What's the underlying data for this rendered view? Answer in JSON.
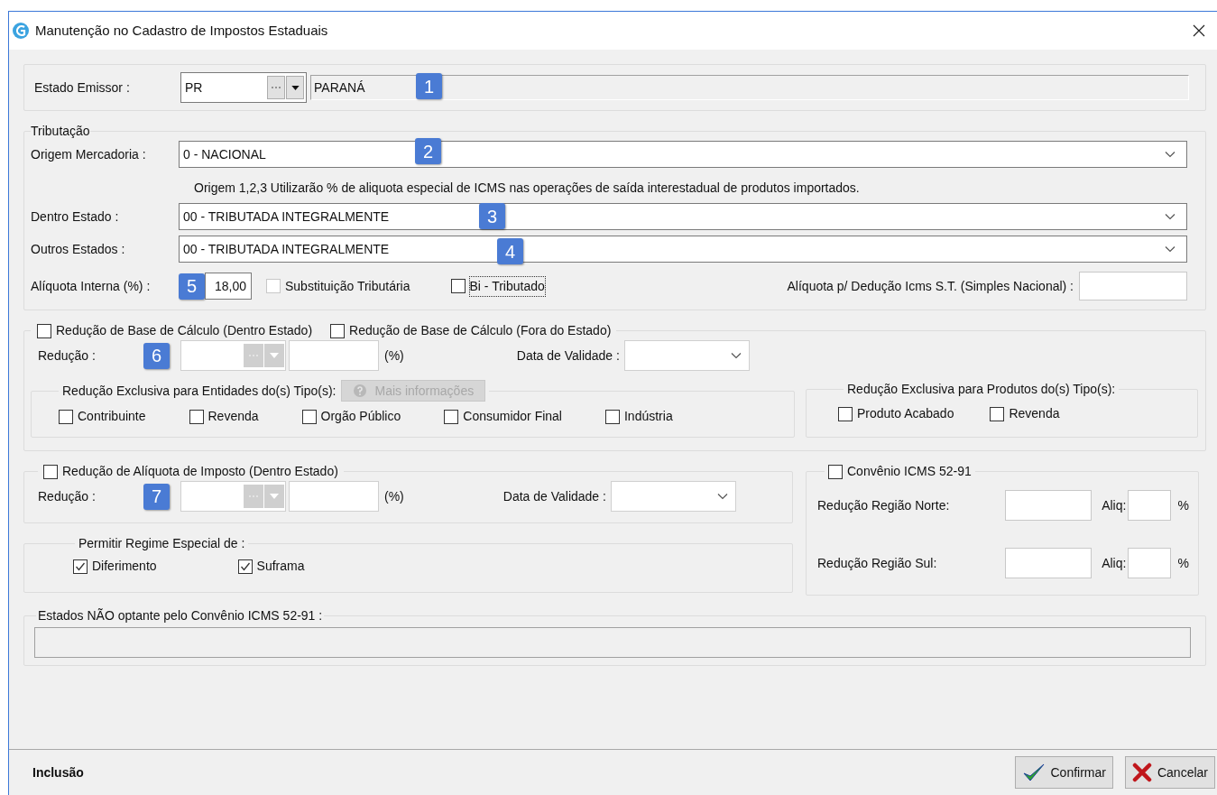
{
  "window": {
    "title": "Manutenção no Cadastro de Impostos Estaduais"
  },
  "estado_emissor": {
    "label": "Estado Emissor :",
    "code": "PR",
    "name": "PARANÁ",
    "badge": "1"
  },
  "tributacao": {
    "legend": "Tributação",
    "origem": {
      "label": "Origem Mercadoria :",
      "value": "0 - NACIONAL",
      "badge": "2"
    },
    "note": "Origem 1,2,3 Utilizarão % de aliquota especial de ICMS nas operações de saída interestadual de produtos importados.",
    "dentro": {
      "label": "Dentro Estado :",
      "value": "00 - TRIBUTADA INTEGRALMENTE",
      "badge": "3"
    },
    "outros": {
      "label": "Outros Estados :",
      "value": "00 - TRIBUTADA INTEGRALMENTE",
      "badge": "4"
    },
    "aliquota": {
      "label": "Alíquota Interna (%) :",
      "value": "18,00",
      "badge": "5"
    },
    "checks": [
      {
        "label": "Substituição Tributária",
        "checked": false,
        "disabled": true,
        "focused": false
      },
      {
        "label": "Bi - Tributado",
        "checked": false,
        "disabled": false,
        "focused": true
      }
    ],
    "deducao": {
      "label": "Alíquota p/ Dedução Icms S.T. (Simples Nacional) :"
    }
  },
  "reducao_base": {
    "legend_checks": [
      {
        "label": "Redução de Base de Cálculo (Dentro Estado)",
        "checked": false
      },
      {
        "label": "Redução de Base de Cálculo (Fora do Estado)",
        "checked": false
      }
    ],
    "reducao_label": "Redução :",
    "badge": "6",
    "percent_label": "(%)",
    "validade_label": "Data de Validade :",
    "entidades": {
      "legend": "Redução Exclusiva para Entidades do(s) Tipo(s):",
      "info_button": {
        "label": "Mais informações",
        "disabled": true
      },
      "options": [
        {
          "label": "Contribuinte",
          "checked": false
        },
        {
          "label": "Revenda",
          "checked": false
        },
        {
          "label": "Orgão Público",
          "checked": false
        },
        {
          "label": "Consumidor Final",
          "checked": false
        },
        {
          "label": "Indústria",
          "checked": false
        }
      ]
    },
    "produtos": {
      "legend": "Redução Exclusiva para Produtos do(s) Tipo(s):",
      "options": [
        {
          "label": "Produto Acabado",
          "checked": false
        },
        {
          "label": "Revenda",
          "checked": false
        }
      ]
    }
  },
  "reducao_aliquota": {
    "legend_check": {
      "label": "Redução de Alíquota de Imposto (Dentro Estado)",
      "checked": false
    },
    "reducao_label": "Redução :",
    "badge": "7",
    "percent_label": "(%)",
    "validade_label": "Data de Validade :"
  },
  "regime": {
    "legend": "Permitir Regime Especial de :",
    "options": [
      {
        "label": "Diferimento",
        "checked": true
      },
      {
        "label": "Suframa",
        "checked": true
      }
    ]
  },
  "convenio": {
    "legend_check": {
      "label": "Convênio ICMS 52-91",
      "checked": false
    },
    "rows": [
      {
        "label": "Redução Região Norte:",
        "aliq_label": "Aliq:",
        "unit": "%"
      },
      {
        "label": "Redução Região Sul:",
        "aliq_label": "Aliq:",
        "unit": "%"
      }
    ]
  },
  "estados_nao_optantes": {
    "legend": "Estados NÃO optante pelo Convênio ICMS 52-91 :"
  },
  "status": "Inclusão",
  "buttons": [
    {
      "kind": "confirm",
      "label": "Confirmar"
    },
    {
      "kind": "cancel",
      "label": "Cancelar"
    }
  ]
}
